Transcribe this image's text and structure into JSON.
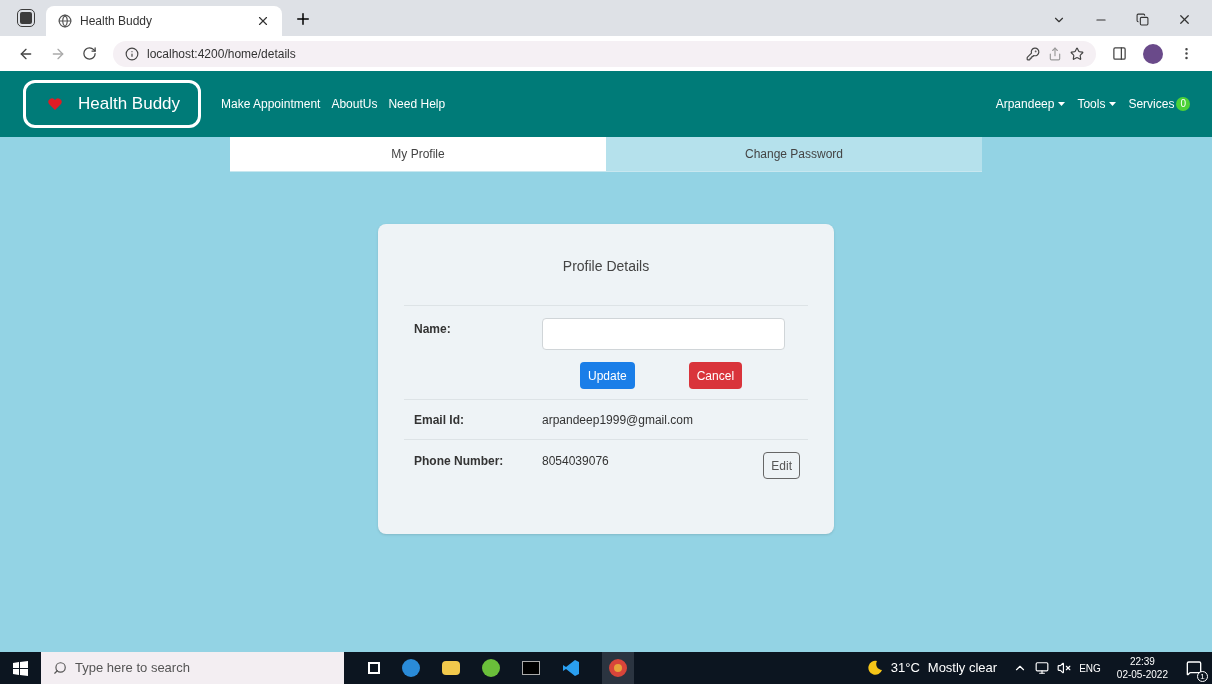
{
  "browser": {
    "tabs": [
      {
        "title": "Health Buddy",
        "selected": true
      }
    ],
    "url": "localhost:4200/home/details"
  },
  "navbar": {
    "brand": "Health Buddy",
    "links": [
      "Make Appointment",
      "AboutUs",
      "Need Help"
    ],
    "right": [
      {
        "label": "Arpandeep",
        "kind": "dropdown"
      },
      {
        "label": "Tools",
        "kind": "dropdown"
      },
      {
        "label": "Services",
        "kind": "badge",
        "badge": "0"
      }
    ]
  },
  "page_tabs": [
    {
      "label": "My Profile",
      "selected": true
    },
    {
      "label": "Change Password",
      "selected": false
    }
  ],
  "card": {
    "title": "Profile Details",
    "rows": [
      {
        "kind": "input",
        "label": "Name:",
        "buttons": [
          "Update",
          "Cancel"
        ]
      },
      {
        "kind": "text",
        "label": "Email Id:",
        "value": "arpandeep1999@gmail.com"
      },
      {
        "kind": "edit",
        "label": "Phone Number:",
        "value": "8054039076",
        "button": "Edit"
      }
    ]
  },
  "taskbar": {
    "search_placeholder": "Type here to search",
    "temperature": "31°C",
    "weather": "Mostly clear",
    "language": "ENG",
    "time": "22:39",
    "date": "02-05-2022",
    "notifications": "1"
  }
}
